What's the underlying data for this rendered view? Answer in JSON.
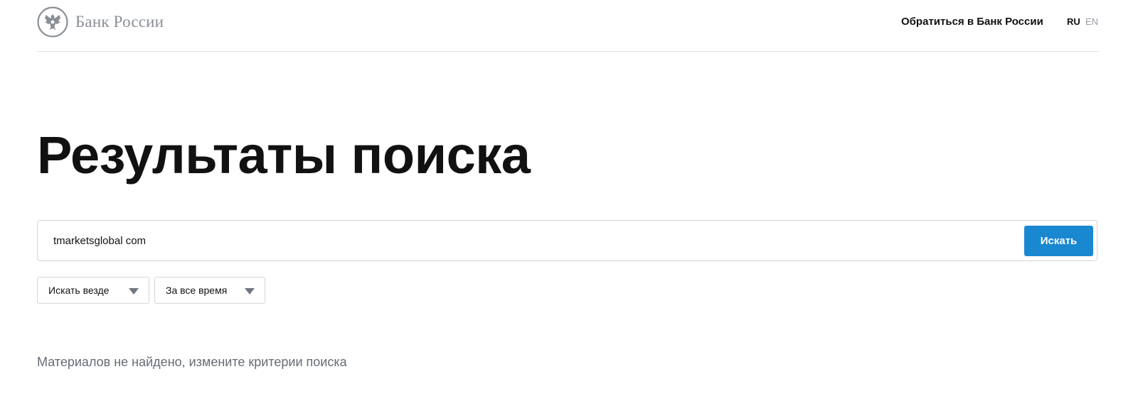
{
  "header": {
    "logo_text": "Банк России",
    "logo_icon": "double-headed-eagle-emblem",
    "contact_link": "Обратиться в Банк России",
    "languages": {
      "ru": "RU",
      "en": "EN",
      "active": "RU"
    }
  },
  "page": {
    "title": "Результаты поиска"
  },
  "search": {
    "query": "tmarketsglobal com",
    "button_label": "Искать"
  },
  "filters": {
    "where": {
      "selected": "Искать везде",
      "icon": "caret-down-icon"
    },
    "period": {
      "selected": "За все время",
      "icon": "caret-down-icon"
    }
  },
  "results": {
    "empty_message": "Материалов не найдено, измените критерии поиска"
  },
  "colors": {
    "accent": "#1a88d1",
    "text": "#111111",
    "muted_text": "#656c75",
    "logo_gray": "#8a8f96",
    "border": "#d3d6da"
  }
}
